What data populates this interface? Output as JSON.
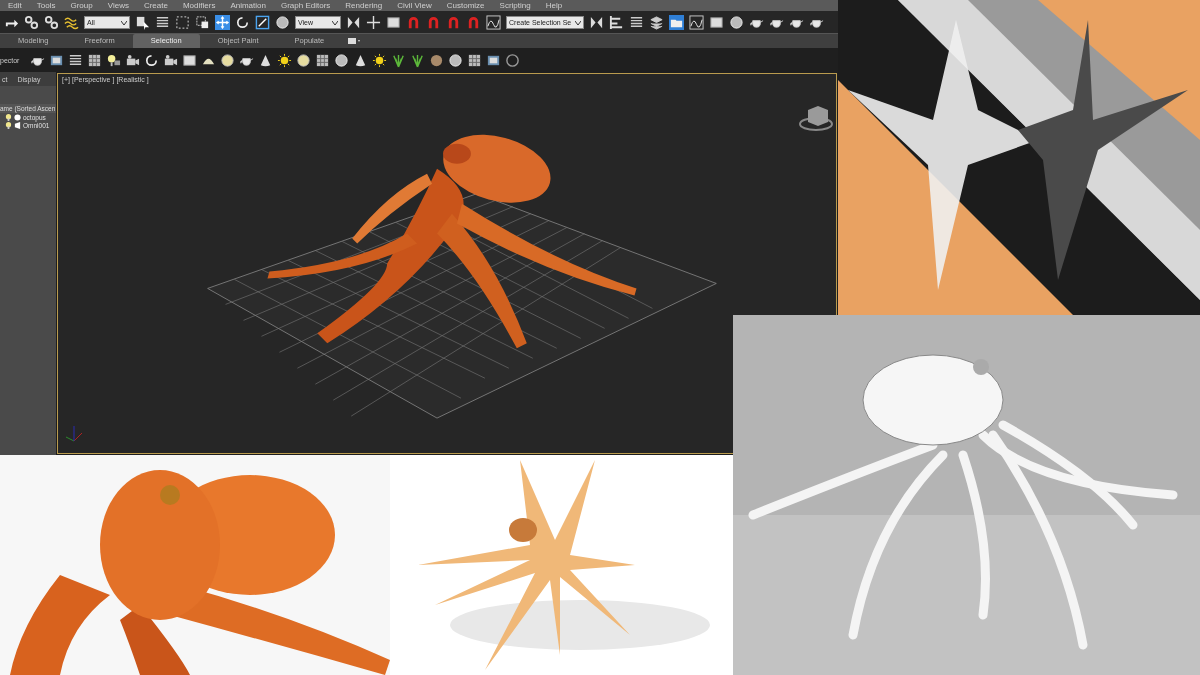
{
  "menu": [
    "Edit",
    "Tools",
    "Group",
    "Views",
    "Create",
    "Modifiers",
    "Animation",
    "Graph Editors",
    "Rendering",
    "Civil View",
    "Customize",
    "Scripting",
    "Help"
  ],
  "toolbar": {
    "dropdowns": [
      "All",
      "View",
      "Create Selection Se"
    ]
  },
  "ribbon_tabs": [
    {
      "label": "Modeling",
      "selected": false
    },
    {
      "label": "Freeform",
      "selected": false
    },
    {
      "label": "Selection",
      "selected": true
    },
    {
      "label": "Object Paint",
      "selected": false
    },
    {
      "label": "Populate",
      "selected": false
    }
  ],
  "ribbon_panel_label": "pector",
  "scene_explorer": {
    "tabs": [
      "ct",
      "Display"
    ],
    "column_header": "ame (Sorted Ascen",
    "items": [
      {
        "name": "octopus",
        "kind": "geometry"
      },
      {
        "name": "Omni001",
        "kind": "light"
      }
    ]
  },
  "viewport": {
    "labels": [
      "[+]",
      "[Perspective ]",
      "[Realistic ]"
    ]
  }
}
